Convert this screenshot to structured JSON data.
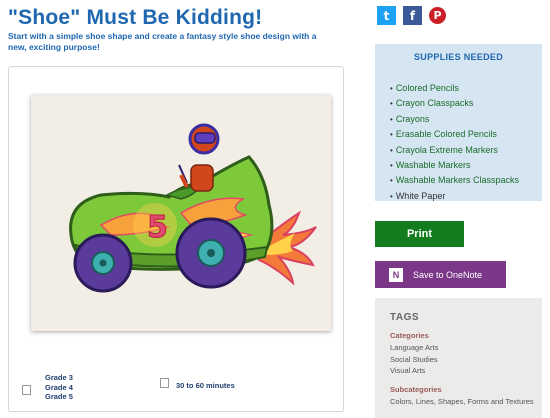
{
  "page": {
    "title": "\"Shoe\" Must Be Kidding!",
    "intro": "Start with a simple shoe shape and create a fantasy style shoe design with a new, exciting purpose!"
  },
  "share": {
    "twitter_icon": "t",
    "facebook_icon": "f",
    "pinterest_icon": "P",
    "colors": {
      "twitter": "#1da1f2",
      "facebook": "#3b5998",
      "pinterest": "#cb2027"
    }
  },
  "artwork": {
    "number_on_car": "5"
  },
  "meta": {
    "grades": [
      "Grade 3",
      "Grade 4",
      "Grade 5"
    ],
    "time": "30 to 60 minutes"
  },
  "supplies": {
    "header": "SUPPLIES NEEDED",
    "items": [
      "Colored Pencils",
      "Crayon Classpacks",
      "Crayons",
      "Erasable Colored Pencils",
      "Crayola Extreme Markers",
      "Washable Markers",
      "Washable Markers Classpacks",
      "White Paper"
    ]
  },
  "actions": {
    "print_label": "Print",
    "onenote_label": "Save to OneNote",
    "onenote_icon": "N"
  },
  "tags": {
    "heading": "TAGS",
    "categories_label": "Categories",
    "categories": [
      "Language Arts",
      "Social Studies",
      "Visual Arts"
    ],
    "subcategories_label": "Subcategories",
    "subcategories": [
      "Colors, Lines, Shapes, Forms and Textures"
    ]
  },
  "colors": {
    "title_blue": "#1f67b0",
    "supplies_bg": "#d5e5f2",
    "supply_link_green": "#1b6b2a",
    "print_green": "#127c1e",
    "onenote_purple": "#7b3788",
    "tags_bg": "#ecebea"
  }
}
